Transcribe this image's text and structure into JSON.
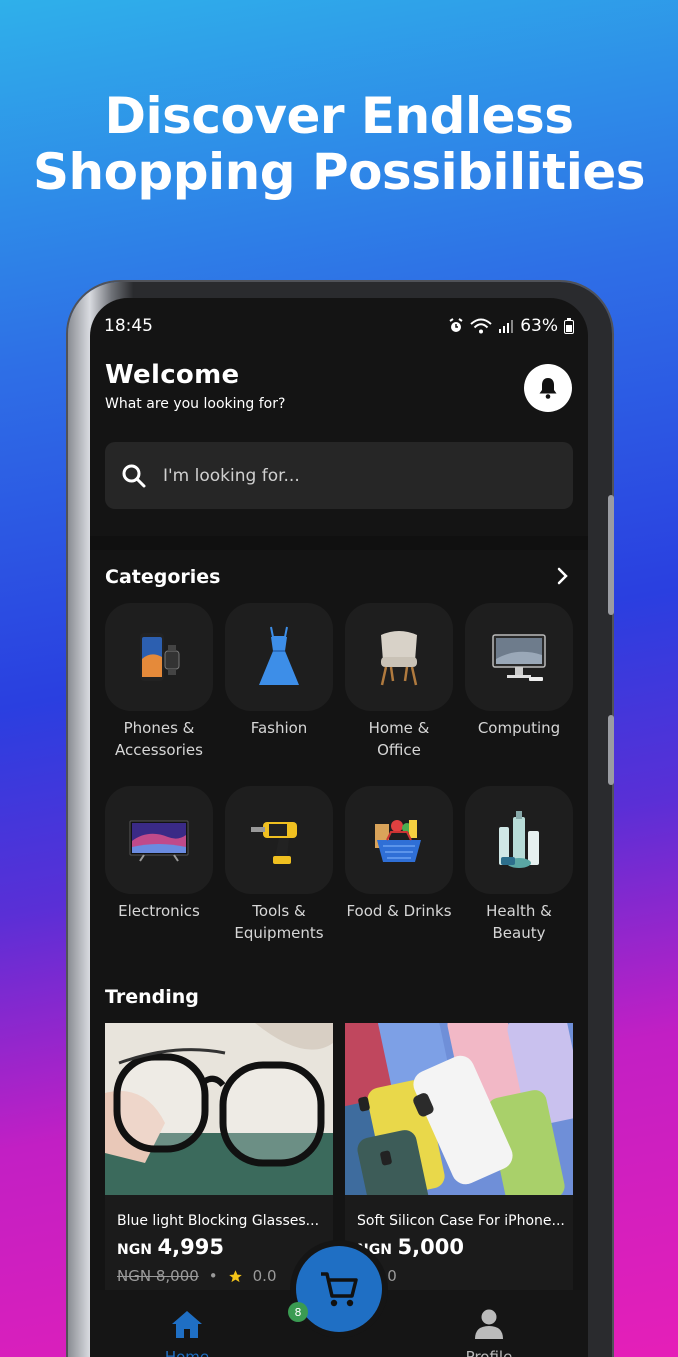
{
  "headline": {
    "line1": "Discover Endless",
    "line2": "Shopping Possibilities"
  },
  "status": {
    "time": "18:45",
    "battery": "63%"
  },
  "header": {
    "title": "Welcome",
    "subtitle": "What are you looking for?"
  },
  "search": {
    "placeholder": "I'm looking for..."
  },
  "categories": {
    "title": "Categories",
    "items": [
      {
        "label": "Phones &\nAccessories",
        "icon": "phone-watch-icon"
      },
      {
        "label": "Fashion",
        "icon": "dress-icon"
      },
      {
        "label": "Home &\nOffice",
        "icon": "chair-icon"
      },
      {
        "label": "Computing",
        "icon": "monitor-icon"
      },
      {
        "label": "Electronics",
        "icon": "tv-icon"
      },
      {
        "label": "Tools &\nEquipments",
        "icon": "drill-icon"
      },
      {
        "label": "Food & Drinks",
        "icon": "grocery-basket-icon"
      },
      {
        "label": "Health &\nBeauty",
        "icon": "cosmetics-icon"
      }
    ]
  },
  "trending": {
    "title": "Trending",
    "products": [
      {
        "name": "Blue light Blocking Glasses...",
        "currency": "NGN",
        "price": "4,995",
        "old_price": "NGN 8,000",
        "rating": "0.0"
      },
      {
        "name": "Soft Silicon Case For iPhone...",
        "currency": "NGN",
        "price": "5,000",
        "old_price": "",
        "rating": "0.0"
      }
    ]
  },
  "nav": {
    "home": "Home",
    "profile": "Profile",
    "cart_count": "8"
  },
  "colors": {
    "accent": "#1f6fc4",
    "background": "#141414",
    "star": "#f5c518"
  }
}
